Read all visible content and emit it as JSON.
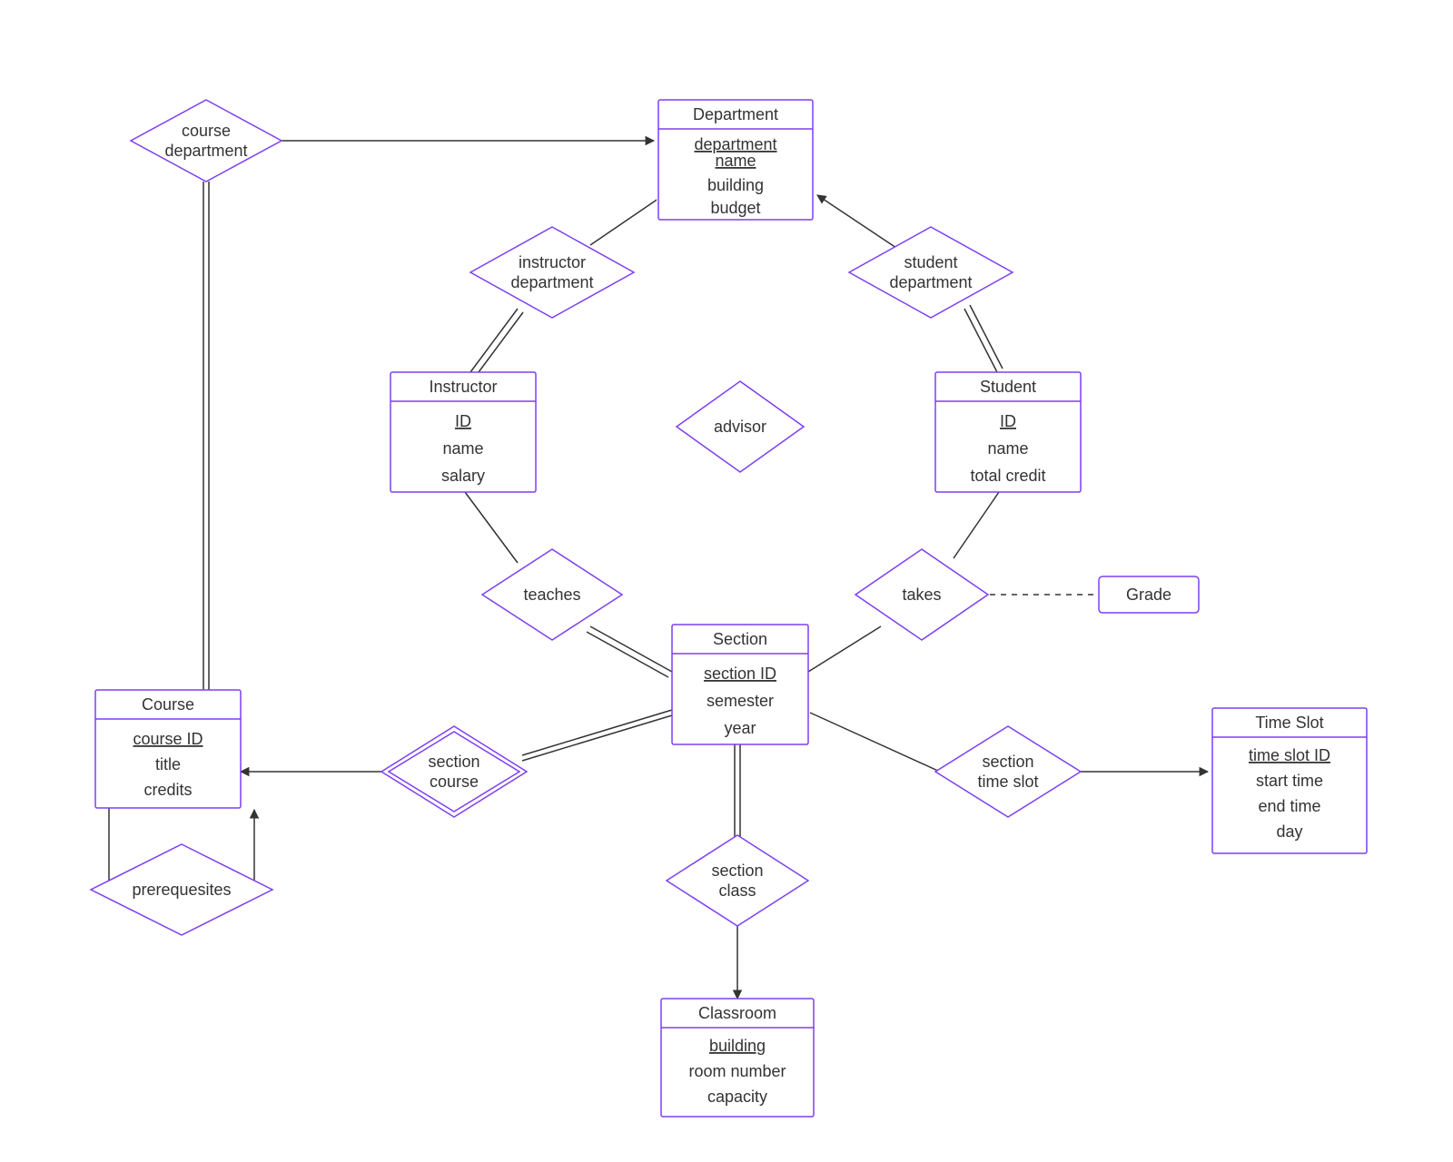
{
  "entities": {
    "department": {
      "title": "Department",
      "attrs": [
        "department name",
        "building",
        "budget"
      ],
      "keys": [
        0
      ]
    },
    "instructor": {
      "title": "Instructor",
      "attrs": [
        "ID",
        "name",
        "salary"
      ],
      "keys": [
        0
      ]
    },
    "student": {
      "title": "Student",
      "attrs": [
        "ID",
        "name",
        "total credit"
      ],
      "keys": [
        0
      ]
    },
    "section": {
      "title": "Section",
      "attrs": [
        "section ID",
        "semester",
        "year"
      ],
      "keys": [
        0
      ]
    },
    "course": {
      "title": "Course",
      "attrs": [
        "course ID",
        "title",
        "credits"
      ],
      "keys": [
        0
      ]
    },
    "timeslot": {
      "title": "Time Slot",
      "attrs": [
        "time slot ID",
        "start time",
        "end time",
        "day"
      ],
      "keys": [
        0
      ]
    },
    "classroom": {
      "title": "Classroom",
      "attrs": [
        "building",
        "room number",
        "capacity"
      ],
      "keys": [
        0
      ]
    },
    "grade": {
      "title": "Grade"
    }
  },
  "relationships": {
    "course_department": {
      "label_lines": [
        "course",
        "department"
      ]
    },
    "instructor_department": {
      "label_lines": [
        "instructor",
        "department"
      ]
    },
    "student_department": {
      "label_lines": [
        "student",
        "department"
      ]
    },
    "advisor": {
      "label_lines": [
        "advisor"
      ]
    },
    "teaches": {
      "label_lines": [
        "teaches"
      ]
    },
    "takes": {
      "label_lines": [
        "takes"
      ]
    },
    "section_course": {
      "label_lines": [
        "section",
        "course"
      ]
    },
    "section_timeslot": {
      "label_lines": [
        "section",
        "time slot"
      ]
    },
    "section_class": {
      "label_lines": [
        "section",
        "class"
      ]
    },
    "prerequisites": {
      "label_lines": [
        "prerequesites"
      ]
    }
  }
}
